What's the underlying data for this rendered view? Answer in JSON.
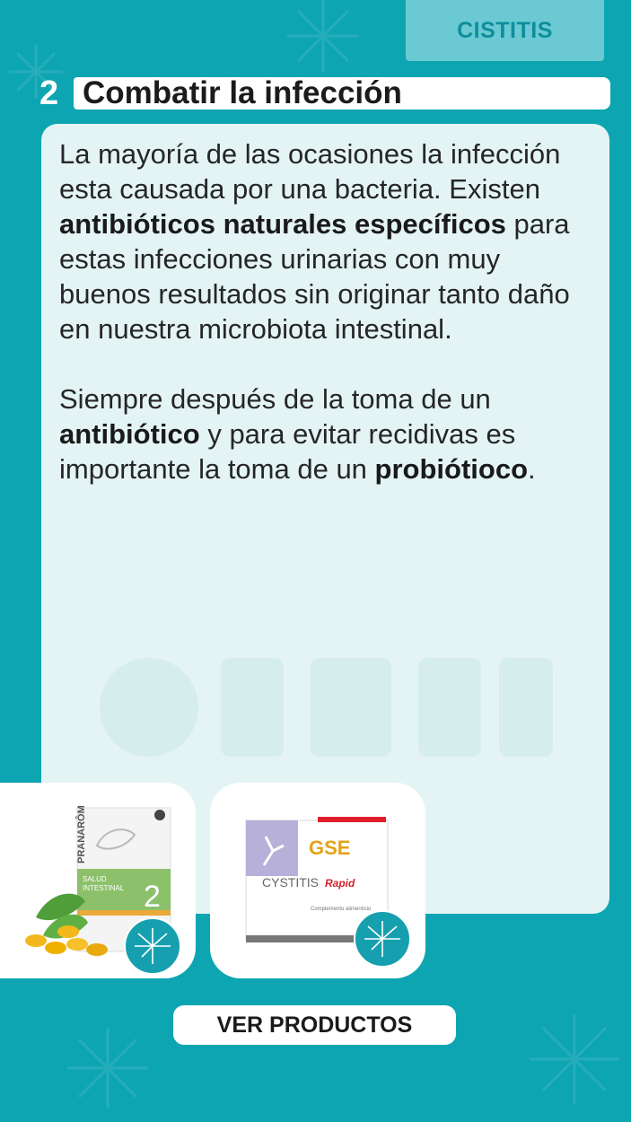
{
  "header": {
    "category_tag": "CISTITIS"
  },
  "section": {
    "number": "2",
    "title": "Combatir la infección"
  },
  "content": {
    "p1_a": "La mayoría de las ocasiones la infección esta causada por una bacteria. Existen ",
    "p1_bold": "antibióticos naturales específicos",
    "p1_b": " para estas infecciones urinarias con muy buenos resultados sin originar tanto daño en nuestra microbiota intestinal.",
    "p2_a": "Siempre después de la toma de un ",
    "p2_bold1": "antibiótico",
    "p2_b": " y para evitar recidivas es importante la toma de un ",
    "p2_bold2": "probiótioco",
    "p2_c": "."
  },
  "products": [
    {
      "brand": "PRANARÔM",
      "line1": "SALUD",
      "line2": "INTESTINAL",
      "number": "2"
    },
    {
      "brand": "GSE",
      "name": "CYSTITIS",
      "variant": "Rapid",
      "subtitle": "Complemento alimenticio"
    }
  ],
  "cta": {
    "label": "VER PRODUCTOS"
  },
  "colors": {
    "background": "#0ea5b2",
    "panel": "#e4f4f4",
    "tag": "#6ac9d2",
    "accent": "#169fae"
  }
}
